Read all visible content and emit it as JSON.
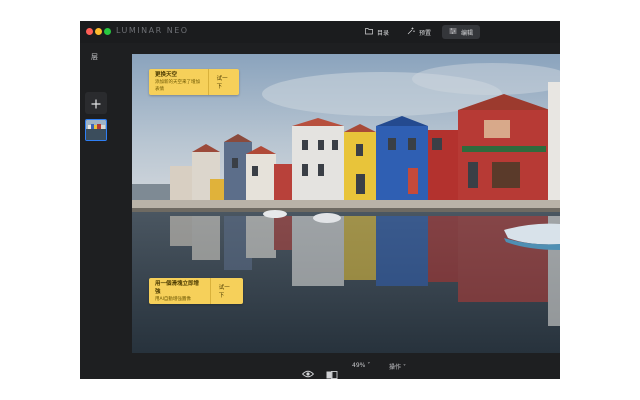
{
  "app": {
    "brand": "LUMINAR NEO"
  },
  "tabs": [
    {
      "label": "目录",
      "icon": "folder-icon"
    },
    {
      "label": "预置",
      "icon": "sparkle-icon"
    },
    {
      "label": "编辑",
      "icon": "sliders-icon"
    }
  ],
  "sidebar": {
    "title": "层",
    "add_icon": "plus-icon"
  },
  "hints": [
    {
      "title": "更换天空",
      "desc": "添加新的天空来了增加表情",
      "action": "试一下"
    },
    {
      "title": "用一個滑塊立即增強",
      "desc": "用AI自動增強圖像",
      "action": "试一下"
    }
  ],
  "bottombar": {
    "zoom": "49%",
    "operations": "操作",
    "eye_icon": "eye-icon",
    "compare_icon": "compare-icon"
  },
  "colors": {
    "window_bg": "#1e1f21",
    "accent": "#2f7ff5",
    "hint_bg": "#f6d05a"
  }
}
